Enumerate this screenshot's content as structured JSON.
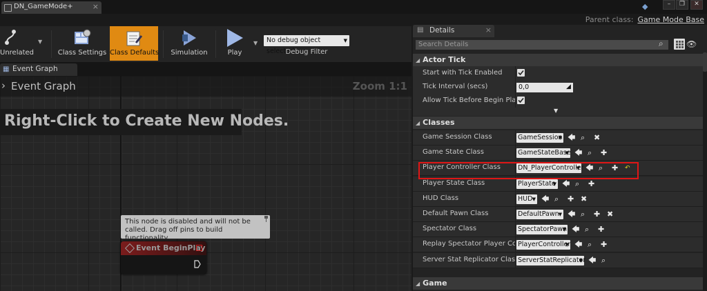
{
  "window": {
    "tab_title": "DN_GameMode+",
    "parent_class_label": "Parent class:",
    "parent_class_value": "Game Mode Base",
    "buttons": {
      "minimize": "–",
      "restore": "❐",
      "close": "✕"
    }
  },
  "toolbar": {
    "unrelated": "Unrelated",
    "class_settings": "Class Settings",
    "class_defaults": "Class Defaults",
    "simulation": "Simulation",
    "play": "Play",
    "debug_object": "No debug object selected",
    "debug_filter": "Debug Filter"
  },
  "graph": {
    "tab_label": "Event Graph",
    "breadcrumb": "Event Graph",
    "zoom": "Zoom 1:1",
    "hint": "Right-Click to Create New Nodes.",
    "tooltip": "This node is disabled and will not be called. Drag off pins to build functionality.",
    "node_title": "Event BeginPlay"
  },
  "details": {
    "tab_label": "Details",
    "search_placeholder": "Search Details",
    "categories": {
      "actor_tick": "Actor Tick",
      "classes": "Classes",
      "game": "Game"
    },
    "actor_tick": {
      "start_with_tick": {
        "label": "Start with Tick Enabled",
        "checked": true
      },
      "tick_interval": {
        "label": "Tick Interval (secs)",
        "value": "0,0"
      },
      "allow_tick_before_play": {
        "label": "Allow Tick Before Begin Play",
        "checked": true
      }
    },
    "classes": [
      {
        "label": "Game Session Class",
        "value": "GameSession",
        "icons": [
          "arrow-left-icon",
          "browse-icon",
          "clear-icon"
        ]
      },
      {
        "label": "Game State Class",
        "value": "GameStateBase",
        "icons": [
          "arrow-left-icon",
          "browse-icon",
          "add-icon"
        ]
      },
      {
        "label": "Player Controller Class",
        "value": "DN_PlayerController",
        "icons": [
          "arrow-left-icon",
          "browse-icon",
          "add-icon",
          "reset-icon"
        ]
      },
      {
        "label": "Player State Class",
        "value": "PlayerState",
        "icons": [
          "arrow-left-icon",
          "browse-icon",
          "add-icon"
        ]
      },
      {
        "label": "HUD Class",
        "value": "HUD",
        "icons": [
          "arrow-left-icon",
          "browse-icon",
          "add-icon",
          "clear-icon"
        ]
      },
      {
        "label": "Default Pawn Class",
        "value": "DefaultPawn",
        "icons": [
          "arrow-left-icon",
          "browse-icon",
          "add-icon",
          "clear-icon"
        ]
      },
      {
        "label": "Spectator Class",
        "value": "SpectatorPawn",
        "icons": [
          "arrow-left-icon",
          "browse-icon",
          "add-icon"
        ]
      },
      {
        "label": "Replay Spectator Player Controller Class",
        "value": "PlayerController",
        "icons": [
          "arrow-left-icon",
          "browse-icon",
          "add-icon"
        ]
      },
      {
        "label": "Server Stat Replicator Class",
        "value": "ServerStatReplicator",
        "icons": [
          "arrow-left-icon",
          "browse-icon"
        ]
      }
    ]
  },
  "colors": {
    "accent": "#e08a12",
    "highlight": "#e01616",
    "node_header": "#7a1c1c"
  }
}
